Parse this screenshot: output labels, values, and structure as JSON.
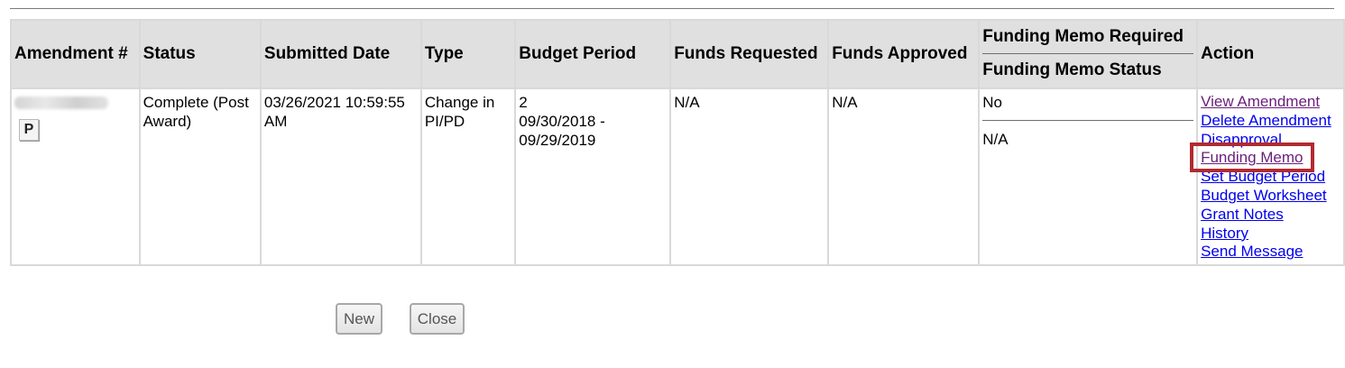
{
  "table": {
    "headers": {
      "amendment": "Amendment #",
      "status": "Status",
      "submitted": "Submitted Date",
      "type": "Type",
      "budget_period": "Budget Period",
      "funds_requested": "Funds Requested",
      "funds_approved": "Funds Approved",
      "memo_required": "Funding Memo Required",
      "memo_status": "Funding Memo Status",
      "action": "Action"
    },
    "row": {
      "amendment_icon": "P",
      "status": "Complete (Post Award)",
      "submitted": "03/26/2021 10:59:55 AM",
      "type": "Change in PI/PD",
      "budget_period_number": "2",
      "budget_period_range": "09/30/2018 - 09/29/2019",
      "funds_requested": "N/A",
      "funds_approved": "N/A",
      "memo_required": "No",
      "memo_status": "N/A",
      "actions": [
        "View Amendment",
        "Delete Amendment",
        "Disapproval",
        "Funding Memo",
        "Set Budget Period",
        "Budget Worksheet",
        "Grant Notes",
        "History",
        "Send Message"
      ]
    }
  },
  "buttons": {
    "new": "New",
    "close": "Close"
  },
  "colors": {
    "link": "#0000ee",
    "visited_link": "#6b1e7a",
    "highlight_box": "#b22a2f",
    "header_bg": "#e0e0e0"
  }
}
